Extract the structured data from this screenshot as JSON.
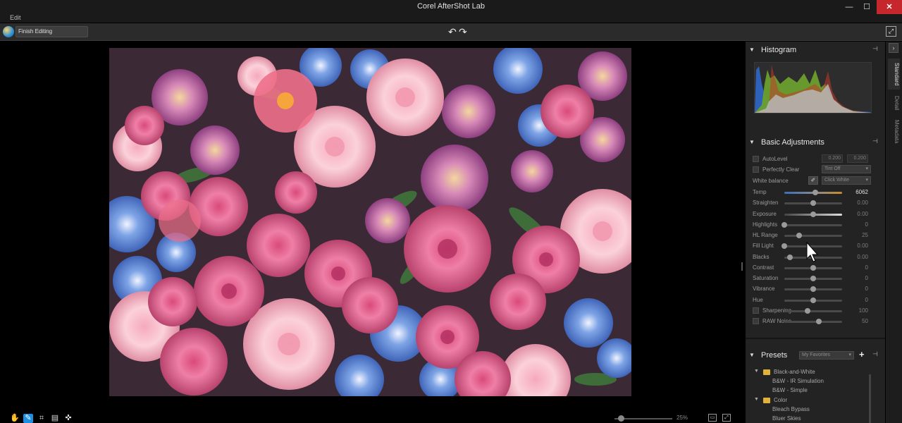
{
  "window": {
    "title": "Corel AfterShot Lab",
    "min_glyph": "—",
    "max_glyph": "☐",
    "close_glyph": "✕"
  },
  "menu": {
    "edit": "Edit"
  },
  "toolbar": {
    "finish_label": "Finish Editing",
    "undo_glyph": "↶",
    "redo_glyph": "↷",
    "fullscreen_glyph": "⤢"
  },
  "bottombar": {
    "zoom_label": "25%",
    "zoom_level": 0.06,
    "tools": [
      {
        "name": "hand-tool",
        "glyph": "✋",
        "active": false
      },
      {
        "name": "brush-tool",
        "glyph": "✎",
        "active": true
      },
      {
        "name": "crop-tool",
        "glyph": "⌗",
        "active": false
      },
      {
        "name": "layers-tool",
        "glyph": "▤",
        "active": false
      },
      {
        "name": "heal-tool",
        "glyph": "✜",
        "active": false
      }
    ]
  },
  "histogram": {
    "title": "Histogram"
  },
  "basic": {
    "title": "Basic Adjustments",
    "autolevel": {
      "label": "AutoLevel",
      "low": "0.200",
      "high": "0.200"
    },
    "perfectly_clear": {
      "label": "Perfectly Clear",
      "option": "Tint Off"
    },
    "white_balance": {
      "label": "White balance",
      "option": "Click White"
    },
    "sliders": [
      {
        "key": "temp",
        "label": "Temp",
        "value": "6062",
        "level": 0.53,
        "has_check": false
      },
      {
        "key": "straighten",
        "label": "Straighten",
        "value": "0.00",
        "level": 0.5,
        "has_check": false
      },
      {
        "key": "exposure",
        "label": "Exposure",
        "value": "0.00",
        "level": 0.5,
        "has_check": false
      },
      {
        "key": "highlights",
        "label": "Highlights",
        "value": "0",
        "level": 0.0,
        "has_check": false
      },
      {
        "key": "hl-range",
        "label": "HL Range",
        "value": "25",
        "level": 0.25,
        "has_check": false
      },
      {
        "key": "fill-light",
        "label": "Fill Light",
        "value": "0.00",
        "level": 0.0,
        "has_check": false
      },
      {
        "key": "blacks",
        "label": "Blacks",
        "value": "0.00",
        "level": 0.1,
        "has_check": false
      },
      {
        "key": "contrast",
        "label": "Contrast",
        "value": "0",
        "level": 0.5,
        "has_check": false
      },
      {
        "key": "saturation",
        "label": "Saturation",
        "value": "0",
        "level": 0.5,
        "has_check": false
      },
      {
        "key": "vibrance",
        "label": "Vibrance",
        "value": "0",
        "level": 0.5,
        "has_check": false
      },
      {
        "key": "hue",
        "label": "Hue",
        "value": "0",
        "level": 0.5,
        "has_check": false
      },
      {
        "key": "sharpening",
        "label": "Sharpening",
        "value": "100",
        "level": 0.4,
        "has_check": true
      },
      {
        "key": "raw-noise",
        "label": "RAW Noise",
        "value": "50",
        "level": 0.6,
        "has_check": true
      }
    ]
  },
  "presets": {
    "title": "Presets",
    "dropdown": "My Favorites",
    "add_glyph": "+",
    "tree": [
      {
        "label": "Black-and-White",
        "type": "folder"
      },
      {
        "label": "B&W - IR Simulation",
        "type": "item"
      },
      {
        "label": "B&W - Simple",
        "type": "item"
      },
      {
        "label": "Color",
        "type": "folder"
      },
      {
        "label": "Bleach Bypass",
        "type": "item"
      },
      {
        "label": "Bluer Skies",
        "type": "item"
      }
    ]
  },
  "side_tabs": {
    "collapse_glyph": "›",
    "standard": "Standard",
    "detail": "Detail",
    "metadata": "Metadata"
  },
  "colors": {
    "accent": "#1e8fe0",
    "close": "#c5272d",
    "folder": "#e0b23a"
  }
}
